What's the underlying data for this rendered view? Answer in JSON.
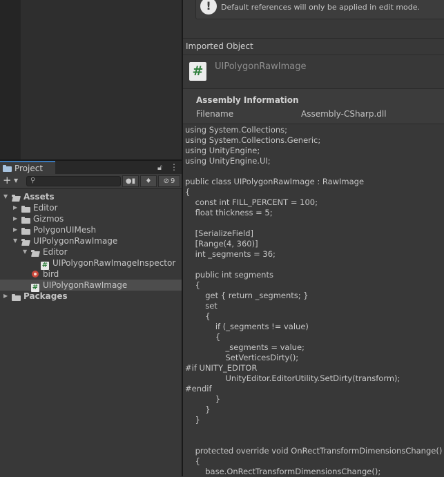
{
  "project_panel": {
    "tab_label": "Project",
    "add_label": "+",
    "hidden_count": "9",
    "search": {
      "placeholder": ""
    }
  },
  "tree": [
    {
      "label": "Assets",
      "depth": 0,
      "expanded": true,
      "type": "folder-open",
      "bold": true
    },
    {
      "label": "Editor",
      "depth": 1,
      "expanded": false,
      "type": "folder"
    },
    {
      "label": "Gizmos",
      "depth": 1,
      "expanded": false,
      "type": "folder"
    },
    {
      "label": "PolygonUIMesh",
      "depth": 1,
      "expanded": false,
      "type": "folder"
    },
    {
      "label": "UIPolygonRawImage",
      "depth": 1,
      "expanded": true,
      "type": "folder-open"
    },
    {
      "label": "Editor",
      "depth": 2,
      "expanded": true,
      "type": "folder-open"
    },
    {
      "label": "UIPolygonRawImageInspector",
      "depth": 3,
      "type": "script"
    },
    {
      "label": "bird",
      "depth": 2,
      "type": "image"
    },
    {
      "label": "UIPolygonRawImage",
      "depth": 2,
      "type": "script",
      "selected": true
    },
    {
      "label": "Packages",
      "depth": 0,
      "expanded": false,
      "type": "folder",
      "bold": true
    }
  ],
  "inspector": {
    "warning_text": "Default references will only be applied in edit mode.",
    "imported_object_label": "Imported Object",
    "object_name": "UIPolygonRawImage",
    "assembly_title": "Assembly Information",
    "filename_label": "Filename",
    "filename_value": "Assembly-CSharp.dll",
    "code": "using System.Collections;\nusing System.Collections.Generic;\nusing UnityEngine;\nusing UnityEngine.UI;\n\npublic class UIPolygonRawImage : RawImage\n{\n    const int FILL_PERCENT = 100;\n    float thickness = 5;\n\n    [SerializeField]\n    [Range(4, 360)]\n    int _segments = 36;\n\n    public int segments\n    {\n        get { return _segments; }\n        set\n        {\n            if (_segments != value)\n            {\n                _segments = value;\n                SetVerticesDirty();\n#if UNITY_EDITOR\n                UnityEditor.EditorUtility.SetDirty(transform);\n#endif\n            }\n        }\n    }\n\n\n    protected override void OnRectTransformDimensionsChange()\n    {\n        base.OnRectTransformDimensionsChange();"
  }
}
